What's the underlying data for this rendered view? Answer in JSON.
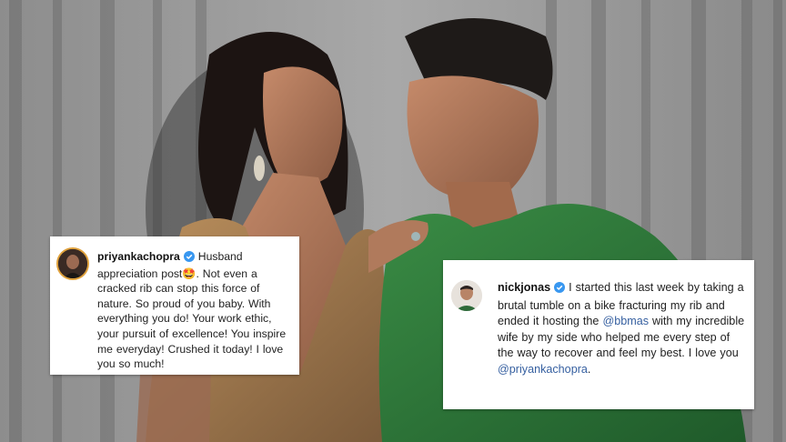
{
  "post_1": {
    "username": "priyankachopra",
    "text_a": "Husband appreciation post",
    "emoji": "🤩",
    "text_b": ". Not even a cracked rib can stop this force of nature. So proud of you baby. With everything you do! Your work ethic, your pursuit of excellence! You inspire me everyday! Crushed it today! I love you so much!"
  },
  "post_2": {
    "username": "nickjonas",
    "text_a": "I started this last week by taking a brutal tumble on a bike fracturing my rib and ended it hosting the",
    "mention_1": "@bbmas",
    "text_b": "with my incredible wife by my side who helped me every step of the way to recover and feel my best. I love you",
    "mention_2": "@priyankachopra",
    "text_c": "."
  },
  "colors": {
    "verified_blue": "#3897f0",
    "mention_blue": "#355fa0",
    "ring_orange": "#e0a13b",
    "jacket_green": "#2f7a3a"
  },
  "icons": [
    "verified-badge-icon",
    "verified-badge-icon"
  ]
}
